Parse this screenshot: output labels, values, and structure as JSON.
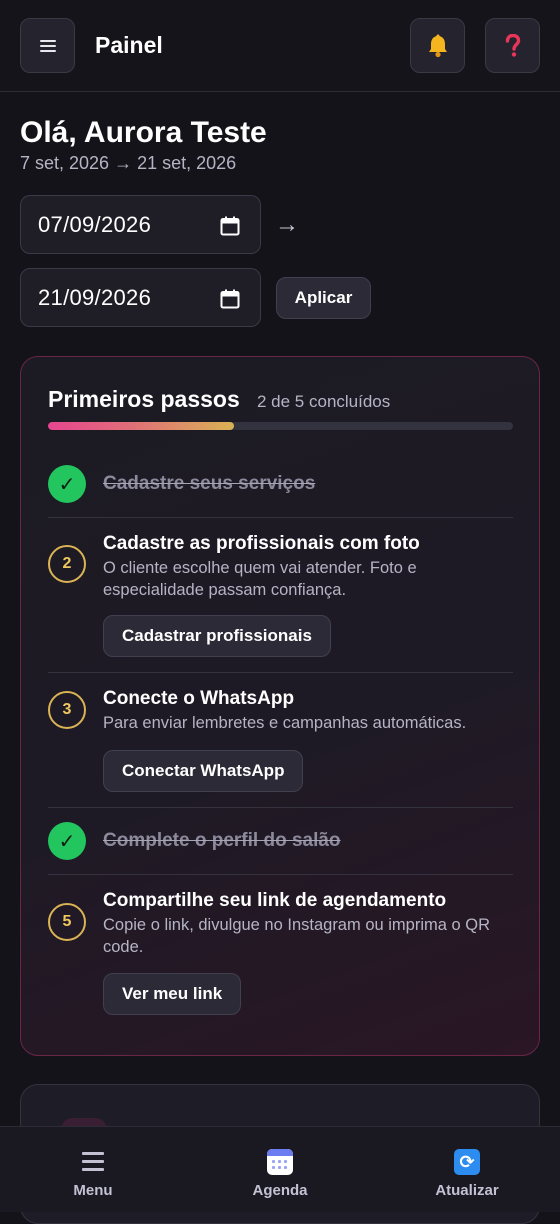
{
  "header": {
    "title": "Painel",
    "menu_icon": "hamburger-icon",
    "bell_icon": "bell-icon",
    "help_icon": "question-icon"
  },
  "greeting": {
    "title": "Olá, Aurora Teste",
    "range": "7 set, 2026 → 21 set, 2026"
  },
  "filters": {
    "date_from": "07/09/2026",
    "date_to": "21/09/2026",
    "arrow": "→",
    "apply_label": "Aplicar"
  },
  "onboarding": {
    "title": "Primeiros passos",
    "count": "2 de 5 concluídos",
    "progress": 0.4,
    "steps": [
      {
        "label": "Cadastre seus serviços",
        "done": true,
        "marker": "✓"
      },
      {
        "label": "Cadastre as profissionais com foto",
        "done": false,
        "marker": "2",
        "description": "O cliente escolhe quem vai atender. Foto e especialidade passam confiança.",
        "button": "Cadastrar profissionais"
      },
      {
        "label": "Conecte o WhatsApp",
        "done": false,
        "marker": "3",
        "description": "Para enviar lembretes e campanhas automáticas.",
        "button": "Conectar WhatsApp"
      },
      {
        "label": "Complete o perfil do salão",
        "done": true,
        "marker": "✓"
      },
      {
        "label": "Compartilhe seu link de agendamento",
        "done": false,
        "marker": "5",
        "description": "Copie o link, divulgue no Instagram ou imprima o QR code.",
        "button": "Ver meu link"
      }
    ]
  },
  "bottom_nav": {
    "items": [
      {
        "label": "Menu",
        "icon": "menu-icon"
      },
      {
        "label": "Agenda",
        "icon": "calendar-icon"
      },
      {
        "label": "Atualizar",
        "icon": "refresh-icon"
      }
    ]
  },
  "colors": {
    "background": "#141319",
    "accent_pink": "#e8458f",
    "accent_gold": "#d9b354",
    "success_green": "#22c55e"
  }
}
